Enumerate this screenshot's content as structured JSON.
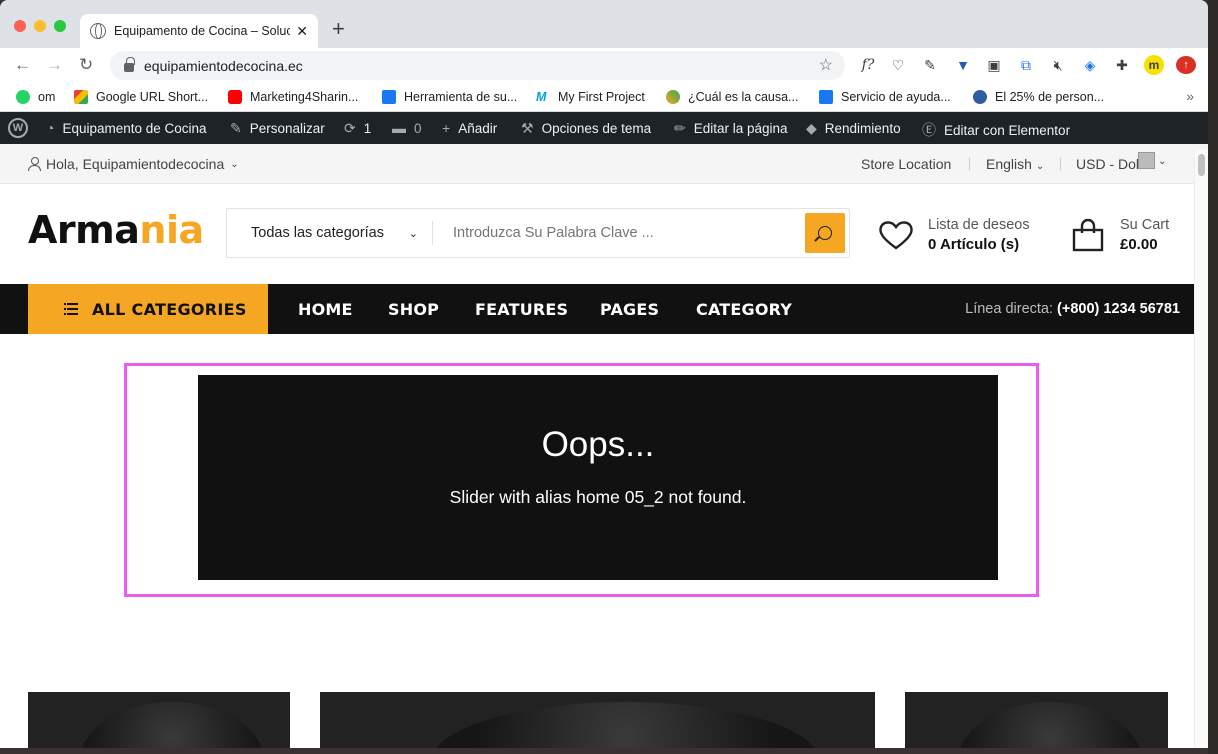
{
  "browser": {
    "tab_title": "Equipamento de Cocina – Soluc",
    "url": "equipamientodecocina.ec",
    "bookmarks": [
      "om",
      "Google URL Short...",
      "Marketing4Sharin...",
      "Herramienta de su...",
      "My First Project",
      "¿Cuál es la causa...",
      "Servicio de ayuda...",
      "El 25% de person..."
    ],
    "bookmark_more": "»",
    "colors": {
      "chrome_bg": "#dee1e6"
    }
  },
  "adminbar": {
    "site": "Equipamento de Cocina",
    "customize": "Personalizar",
    "updates": "1",
    "comments": "0",
    "add_new": "Añadir",
    "theme_options": "Opciones de tema",
    "edit_page": "Editar la página",
    "performance": "Rendimiento",
    "elementor": "Editar con Elementor"
  },
  "topbar": {
    "greeting": "Hola, Equipamientodecocina",
    "store_location": "Store Location",
    "language": "English",
    "currency": "USD - Dol"
  },
  "header": {
    "logo_main": "Arma",
    "logo_accent": "nia",
    "search_category": "Todas las categorías",
    "search_placeholder": "Introduzca Su Palabra Clave ...",
    "wishlist_label": "Lista de deseos",
    "wishlist_count": "0 Artículo (s)",
    "cart_label": "Su Cart",
    "cart_total": "£0.00",
    "colors": {
      "accent": "#f5a623"
    }
  },
  "nav": {
    "all_categories": "ALL CATEGORIES",
    "links": [
      "HOME",
      "SHOP",
      "FEATURES",
      "PAGES",
      "CATEGORY"
    ],
    "hotline_label": "Línea directa:",
    "hotline_number": "(+800) 1234 56781"
  },
  "slider": {
    "title": "Oops...",
    "message": "Slider with alias home 05_2 not found.",
    "colors": {
      "frame": "#ee5bf0"
    }
  }
}
